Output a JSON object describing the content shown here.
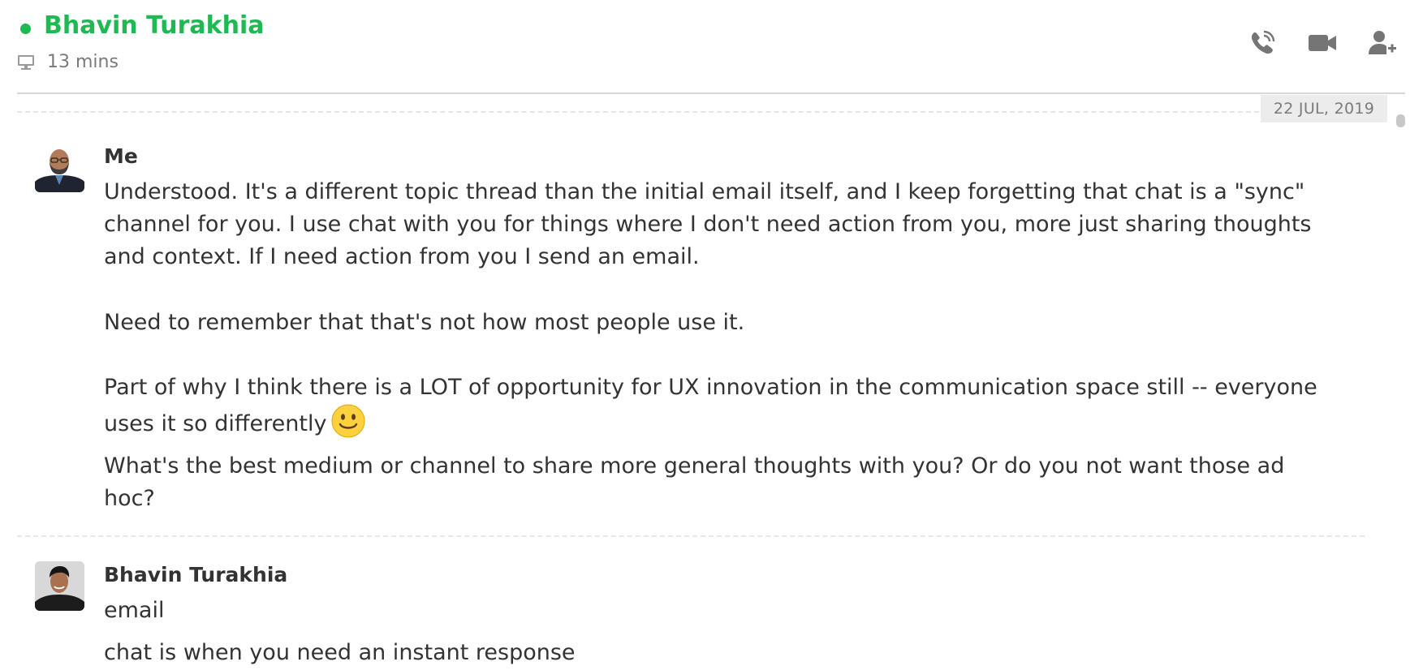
{
  "header": {
    "contact_name": "Bhavin Turakhia",
    "status": "online",
    "status_color": "#1fb953",
    "last_seen": "13 mins",
    "device_icon": "monitor-icon",
    "actions": [
      {
        "name": "voice-call",
        "icon": "phone-icon"
      },
      {
        "name": "video-call",
        "icon": "video-camera-icon"
      },
      {
        "name": "add-participant",
        "icon": "add-user-icon"
      }
    ]
  },
  "date_separator": "22 JUL, 2019",
  "messages": [
    {
      "sender": "Me",
      "avatar": "avatar-me",
      "paragraphs": [
        "Understood. It's a different topic thread than the initial email itself, and I keep forgetting that chat is a \"sync\" channel for you. I use chat with you for things where I don't need action from you, more just sharing thoughts and context. If I need action from you I send an email.",
        "Need to remember that that's not how most people use it.",
        "Part of why I think there is a LOT of opportunity for UX innovation in the communication space still -- everyone uses it so differently",
        "What's the best medium or channel to share more general thoughts with you? Or do you not want those ad hoc?"
      ],
      "emoji": "slightly-smiling-face-icon"
    },
    {
      "sender": "Bhavin Turakhia",
      "avatar": "avatar-bhavin",
      "paragraphs": [
        "email",
        "chat is when you need an instant response"
      ]
    }
  ]
}
